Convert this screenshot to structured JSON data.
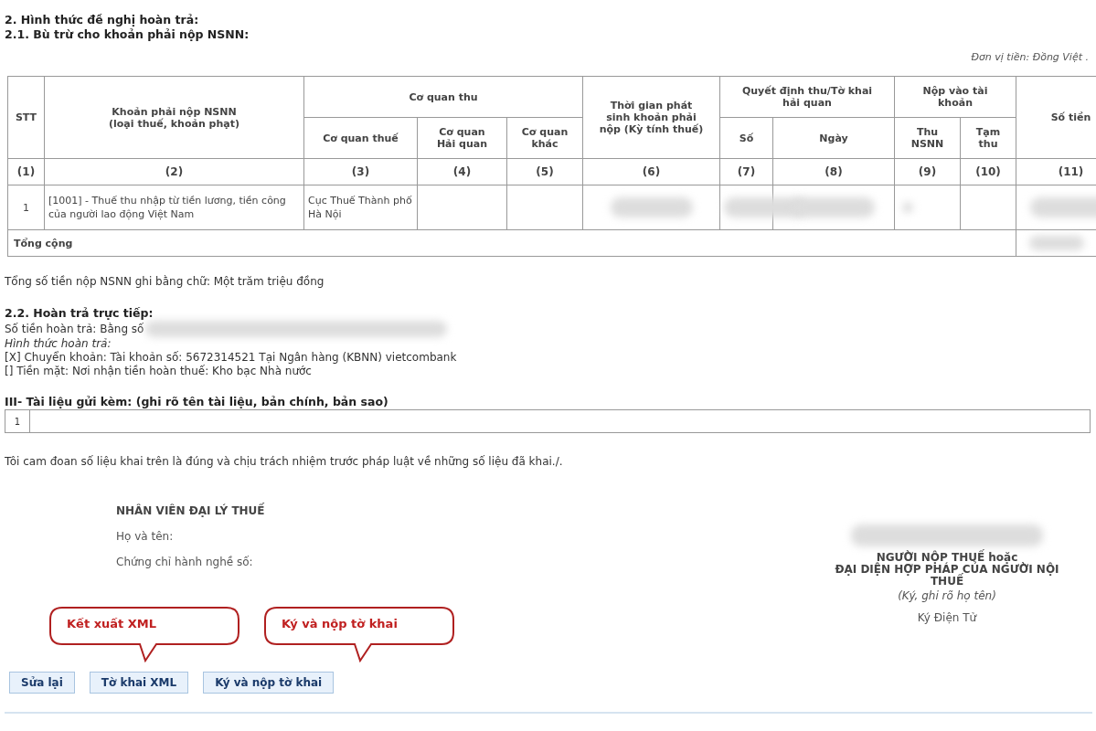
{
  "headings": [
    "2. Hình thức đề nghị hoàn trả:",
    "2.1. Bù trừ cho khoản phải nộp NSNN:"
  ],
  "unit_note": "Đơn vị tiền: Đồng Việt .",
  "table": {
    "columns": [
      {
        "label": "STT"
      },
      {
        "label": "Khoản phải nộp NSNN\n(loại thuế, khoản phạt)"
      },
      {
        "label": "Cơ quan thu",
        "children": [
          {
            "label": "Cơ quan thuế"
          },
          {
            "label": "Cơ quan\nHải quan"
          },
          {
            "label": "Cơ quan\nkhác"
          }
        ]
      },
      {
        "label": "Thời gian phát\nsinh khoản phải\nnộp (Kỳ tính thuế)"
      },
      {
        "label": "Quyết định thu/Tờ khai\nhải quan",
        "children": [
          {
            "label": "Số"
          },
          {
            "label": "Ngày"
          }
        ]
      },
      {
        "label": "Nộp vào tài\nkhoản",
        "children": [
          {
            "label": "Thu\nNSNN"
          },
          {
            "label": "Tạm\nthu"
          }
        ]
      },
      {
        "label": "Số tiền"
      }
    ],
    "numbers": [
      "(1)",
      "(2)",
      "(3)",
      "(4)",
      "(5)",
      "(6)",
      "(7)",
      "(8)",
      "(9)",
      "(10)",
      "(11)"
    ],
    "rows": [
      {
        "cells": [
          {
            "text": "1",
            "blurred": false
          },
          {
            "text": "[1001] - Thuế thu nhập từ tiền lương, tiền công của người lao động Việt Nam",
            "blurred": false
          },
          {
            "text": "Cục Thuế Thành phố Hà Nội",
            "blurred": false
          },
          {
            "blurred": false
          },
          {
            "blurred": false
          },
          {
            "blurred": true
          },
          {
            "blurred": true
          },
          {
            "blurred": true
          },
          {
            "blurred": true
          },
          {
            "blurred": false
          },
          {
            "blurred": true
          }
        ]
      }
    ],
    "total": {
      "label": "Tổng cộng",
      "blurred": true
    }
  },
  "total_in_words": "Tổng số tiền nộp NSNN ghi bằng chữ: Một trăm triệu đồng",
  "direct_refund": {
    "heading": "2.2. Hoàn trả trực tiếp:",
    "amount_label": "Số tiền hoàn trả: Bằng số",
    "amount_blurred": true,
    "method_label": "Hình thức hoàn trả:",
    "options": [
      "[X] Chuyển khoản: Tài khoản số: 5672314521 Tại Ngân hàng (KBNN) vietcombank",
      "[] Tiền mặt: Nơi nhận tiền hoàn thuế: Kho bạc Nhà nước"
    ]
  },
  "attachments": {
    "heading": "III- Tài liệu gửi kèm: (ghi rõ tên tài liệu, bản chính, bản sao)",
    "rows": [
      {
        "index": "1"
      }
    ]
  },
  "declaration": "Tôi cam đoan số liệu khai trên là đúng và chịu trách nhiệm trước pháp luật về những số liệu đã khai./.",
  "agent": {
    "title": "NHÂN VIÊN ĐẠI LÝ THUẾ",
    "fields": [
      "Họ và tên:",
      "Chứng chỉ hành nghề số:"
    ]
  },
  "taxpayer": {
    "name_blurred": true,
    "title": "NGƯỜI NỘP THUẾ hoặc\nĐẠI DIỆN HỢP PHÁP CỦA NGƯỜI NỘI\nTHUẾ",
    "note": "(Ký, ghi rõ họ tên)",
    "signature": "Ký Điện Tử"
  },
  "callouts": [
    "Kết xuất XML",
    "Ký và nộp tờ khai"
  ],
  "buttons": [
    "Sửa lại",
    "Tờ khai XML",
    "Ký và nộp tờ khai"
  ]
}
